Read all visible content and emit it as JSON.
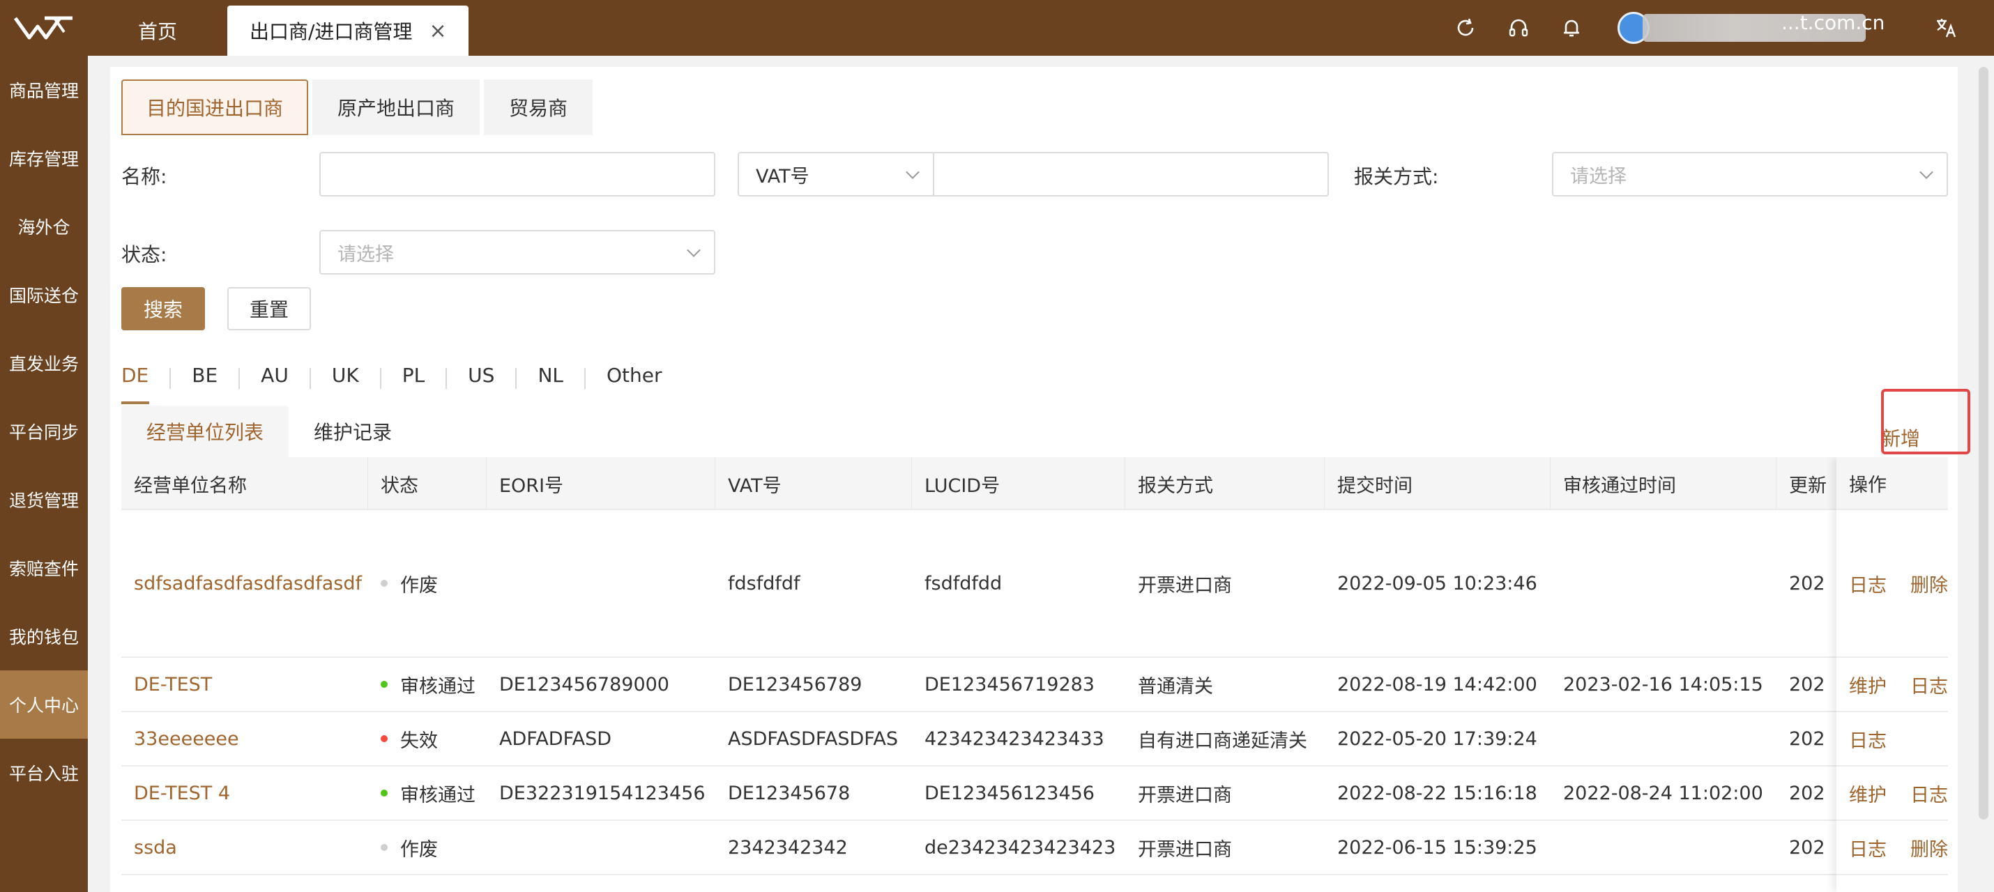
{
  "colors": {
    "brand": "#6b4220",
    "accent": "#a87a48",
    "link": "#a0652e",
    "highlight": "#e04848"
  },
  "topbar": {
    "home_tab": "首页",
    "active_tab": "出口商/进口商管理",
    "close_glyph": "×",
    "icons": [
      "refresh-icon",
      "headset-icon",
      "bell-icon",
      "translate-icon"
    ],
    "user_email": "...t.com.cn"
  },
  "sidebar": {
    "items": [
      "商品管理",
      "库存管理",
      "海外仓",
      "国际送仓",
      "直发业务",
      "平台同步",
      "退货管理",
      "索赔查件",
      "我的钱包",
      "个人中心",
      "平台入驻"
    ],
    "active_index": 9
  },
  "type_tabs": [
    "目的国进出口商",
    "原产地出口商",
    "贸易商"
  ],
  "filters": {
    "name_label": "名称:",
    "vat_select": "VAT号",
    "customs_label": "报关方式:",
    "customs_placeholder": "请选择",
    "status_label": "状态:",
    "status_placeholder": "请选择",
    "search_button": "搜索",
    "reset_button": "重置"
  },
  "country_tabs": [
    "DE",
    "BE",
    "AU",
    "UK",
    "PL",
    "US",
    "NL",
    "Other"
  ],
  "list_tabs": [
    "经营单位列表",
    "维护记录"
  ],
  "add_button": "新增",
  "table": {
    "columns": [
      "经营单位名称",
      "状态",
      "EORI号",
      "VAT号",
      "LUCID号",
      "报关方式",
      "提交时间",
      "审核通过时间",
      "更新",
      "操作"
    ],
    "rows": [
      {
        "name": "sdfsadfasdfasdfasdfasdf",
        "status": "作废",
        "status_color": "#cfcfcf",
        "eori": "",
        "vat": "fdsfdfdf",
        "lucid": "fsdfdfdd",
        "customs": "开票进口商",
        "submitted": "2022-09-05 10:23:46",
        "approved": "",
        "updated": "202",
        "actions": [
          "日志",
          "删除"
        ]
      },
      {
        "name": "DE-TEST",
        "status": "审核通过",
        "status_color": "#52c41a",
        "eori": "DE123456789000",
        "vat": "DE123456789",
        "lucid": "DE123456719283",
        "customs": "普通清关",
        "submitted": "2022-08-19 14:42:00",
        "approved": "2023-02-16 14:05:15",
        "updated": "202",
        "actions": [
          "维护",
          "日志"
        ]
      },
      {
        "name": "33eeeeeee",
        "status": "失效",
        "status_color": "#f5483b",
        "eori": "ADFADFASD",
        "vat": "ASDFASDFASDFAS",
        "lucid": "423423423423433",
        "customs": "自有进口商递延清关",
        "submitted": "2022-05-20 17:39:24",
        "approved": "",
        "updated": "202",
        "actions": [
          "日志"
        ]
      },
      {
        "name": "DE-TEST 4",
        "status": "审核通过",
        "status_color": "#52c41a",
        "eori": "DE322319154123456",
        "vat": "DE12345678",
        "lucid": "DE123456123456",
        "customs": "开票进口商",
        "submitted": "2022-08-22 15:16:18",
        "approved": "2022-08-24 11:02:00",
        "updated": "202",
        "actions": [
          "维护",
          "日志"
        ]
      },
      {
        "name": "ssda",
        "status": "作废",
        "status_color": "#cfcfcf",
        "eori": "",
        "vat": "2342342342",
        "lucid": "de23423423423423",
        "customs": "开票进口商",
        "submitted": "2022-06-15 15:39:25",
        "approved": "",
        "updated": "202",
        "actions": [
          "日志",
          "删除"
        ]
      }
    ]
  }
}
